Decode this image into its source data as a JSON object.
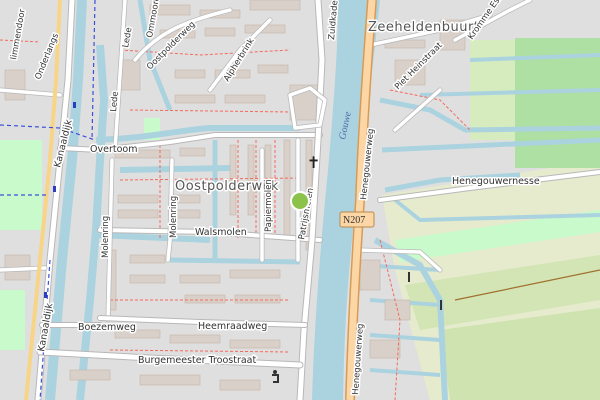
{
  "map": {
    "places": {
      "neighbourhood_west": "Oostpolderwijk",
      "neighbourhood_east": "Zeeheldenbuurt"
    },
    "water": {
      "river": "Gouwe"
    },
    "streets": {
      "kanaaldijk": "Kanaaldijk",
      "boezemweg": "Boezemweg",
      "heemraadweg": "Heemraadweg",
      "burgemeester_troost": "Burgemeester Troostraat",
      "walsmolen": "Walsmolen",
      "molenring": "Molenring",
      "papiermolen": "Papiermolen",
      "patrijsmolen": "Patrijsmolen",
      "oostpolderweg": "Oostpolderweg",
      "alpherbrink": "Alpherbrink",
      "overtoom": "Overtoom",
      "lede": "Lede",
      "onderlangs": "Onderlangs",
      "zuidkade": "Zuidkade",
      "piet_heinstraat": "Piet Heinstraat",
      "kromme_esse": "Kromme Esse",
      "henegouwerweg": "Henegouwerweg",
      "henegouwernesse": "Henegouwernesse",
      "limmendoor": "limmendoor",
      "ommoord": "Ommoord"
    },
    "shields": {
      "n207": "N207"
    },
    "markers": {
      "church_symbol": "✝",
      "pin_color": "#8bc34a"
    },
    "colors": {
      "water": "#aad3df",
      "residential": "#e0dfdf",
      "farmland": "#eef0d5",
      "grass": "#c8facc",
      "orchard": "#aedfa3",
      "motorway_casing": "#e0a35a",
      "primary_road": "#fcd6a4",
      "dashed_boundary": "#3b4fd8"
    }
  }
}
